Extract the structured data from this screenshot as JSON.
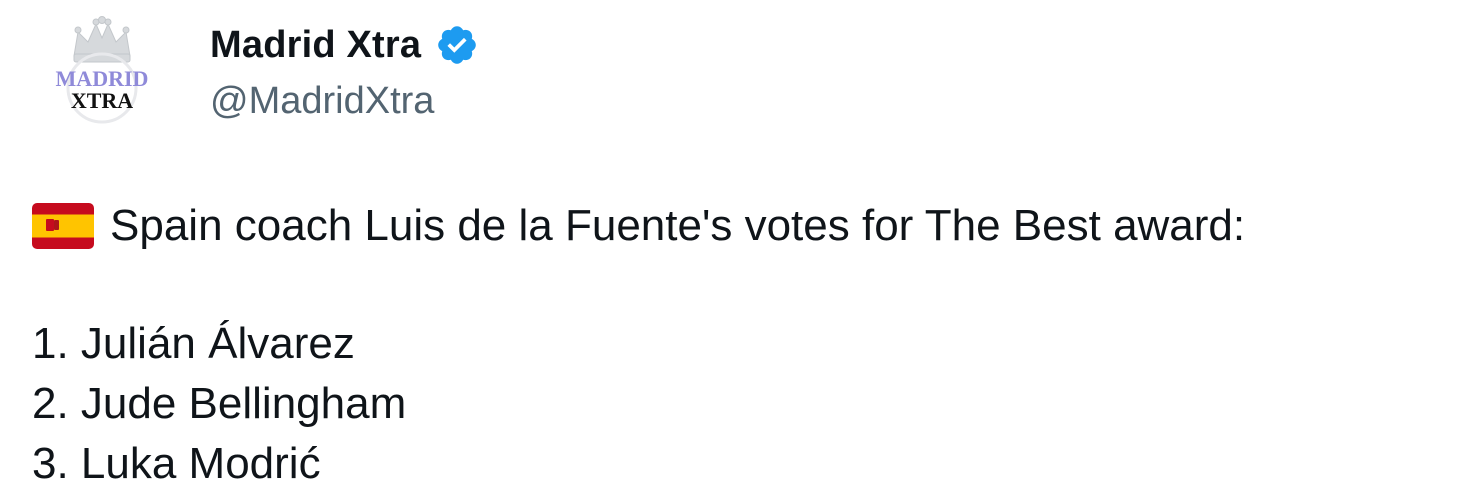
{
  "author": {
    "display_name": "Madrid Xtra",
    "handle": "@MadridXtra",
    "verified_icon": "verified-badge-icon",
    "avatar_text_top": "MADRID",
    "avatar_text_bottom": "XTRA"
  },
  "tweet": {
    "flag_icon": "spain-flag-icon",
    "headline": "Spain coach Luis de la Fuente's votes for The Best award:",
    "votes": [
      "1. Julián Álvarez",
      "2. Jude Bellingham",
      "3. Luka Modrić"
    ]
  },
  "colors": {
    "verified_blue": "#1d9bf0",
    "handle_gray": "#536471",
    "text": "#0f1419",
    "flag_red": "#c60b1e",
    "flag_yellow": "#ffc400"
  }
}
